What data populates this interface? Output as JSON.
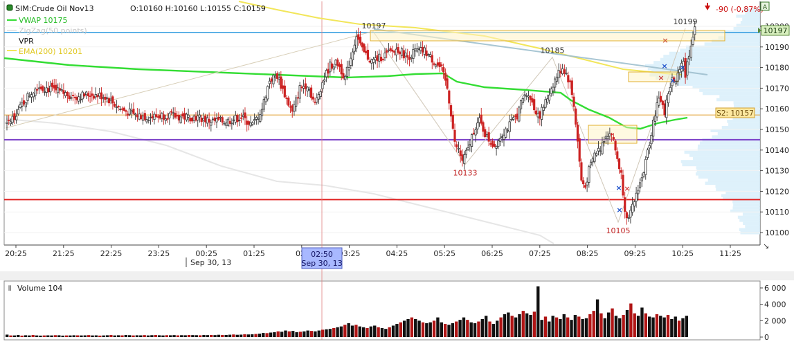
{
  "header": {
    "instrument": "SIM:Crude Oil Nov13",
    "ohlc": "O:10160 H:10160 L:10155 C:10159",
    "change": "-90 (-0,87%)"
  },
  "legend": {
    "vwap": "VWAP  10175",
    "zigzag": "ZigZag(50 points)",
    "vpr": "VPR",
    "ema": "EMA(200)  10201"
  },
  "colors": {
    "candle_up": "#333333",
    "candle_down": "#cc2222",
    "vwap": "#33dd33",
    "ema": "#f2e65a",
    "blue_line": "#3aa0e0",
    "purple_line": "#7a3fc8",
    "red_line": "#e02020",
    "s2_line": "#e0a030",
    "crosshair": "#e08080",
    "volume_up": "#111111",
    "volume_down": "#b01515"
  },
  "chart_data": [
    {
      "type": "candlestick",
      "ylim": [
        10095,
        10210
      ],
      "y_ticks": [
        "10100",
        "10110",
        "10120",
        "10130",
        "10140",
        "10150",
        "10160",
        "10170",
        "10180",
        "10190",
        "10200"
      ],
      "x_tick_labels": [
        "20:25",
        "21:25",
        "22:25",
        "23:25",
        "00:25",
        "01:25",
        "02:",
        "03:25",
        "04:25",
        "05:25",
        "06:25",
        "07:25",
        "08:25",
        "09:25",
        "10:25",
        "11:25"
      ],
      "date_label": "Sep 30, 13",
      "cursor_time": "02:50",
      "cursor_date": "Sep 30, 13",
      "last_price_label": "10197",
      "support_label": "S2: 10157",
      "zigzag_points": [
        {
          "time": "03:55",
          "price": 10197,
          "label": "10197"
        },
        {
          "time": "05:45",
          "price": 10133,
          "label": "10133"
        },
        {
          "time": "07:35",
          "price": 10185,
          "label": "10185"
        },
        {
          "time": "08:55",
          "price": 10105,
          "label": "10105"
        },
        {
          "time": "10:25",
          "price": 10199,
          "label": "10199"
        }
      ],
      "levels": [
        {
          "name": "blue",
          "price": 10197
        },
        {
          "name": "s2",
          "price": 10157
        },
        {
          "name": "purple",
          "price": 10145
        },
        {
          "name": "red",
          "price": 10116
        }
      ],
      "price_path": [
        [
          0,
          10152
        ],
        [
          5,
          10158
        ],
        [
          11,
          10166
        ],
        [
          16,
          10171
        ],
        [
          21,
          10170
        ],
        [
          28,
          10168
        ],
        [
          36,
          10166
        ],
        [
          44,
          10167
        ],
        [
          52,
          10166
        ],
        [
          60,
          10160
        ],
        [
          68,
          10157
        ],
        [
          76,
          10156
        ],
        [
          84,
          10157
        ],
        [
          92,
          10156
        ],
        [
          100,
          10156
        ],
        [
          108,
          10154
        ],
        [
          116,
          10154
        ],
        [
          124,
          10156
        ],
        [
          130,
          10152
        ],
        [
          135,
          10160
        ],
        [
          139,
          10174
        ],
        [
          143,
          10176
        ],
        [
          147,
          10167
        ],
        [
          151,
          10158
        ],
        [
          155,
          10170
        ],
        [
          159,
          10172
        ],
        [
          163,
          10162
        ],
        [
          167,
          10173
        ],
        [
          171,
          10181
        ],
        [
          175,
          10182
        ],
        [
          179,
          10175
        ],
        [
          182,
          10185
        ],
        [
          185,
          10196
        ],
        [
          188,
          10188
        ],
        [
          193,
          10183
        ],
        [
          200,
          10186
        ],
        [
          207,
          10189
        ],
        [
          212,
          10185
        ],
        [
          216,
          10188
        ],
        [
          221,
          10188
        ],
        [
          225,
          10184
        ],
        [
          230,
          10179
        ],
        [
          233,
          10170
        ],
        [
          235,
          10158
        ],
        [
          237,
          10143
        ],
        [
          239,
          10140
        ],
        [
          241,
          10135
        ],
        [
          244,
          10140
        ],
        [
          247,
          10150
        ],
        [
          250,
          10154
        ],
        [
          254,
          10146
        ],
        [
          258,
          10142
        ],
        [
          262,
          10148
        ],
        [
          266,
          10152
        ],
        [
          270,
          10157
        ],
        [
          273,
          10165
        ],
        [
          276,
          10168
        ],
        [
          279,
          10160
        ],
        [
          282,
          10157
        ],
        [
          285,
          10163
        ],
        [
          288,
          10170
        ],
        [
          291,
          10176
        ],
        [
          294,
          10180
        ],
        [
          296,
          10177
        ],
        [
          298,
          10172
        ],
        [
          300,
          10162
        ],
        [
          302,
          10144
        ],
        [
          304,
          10125
        ],
        [
          306,
          10122
        ],
        [
          308,
          10130
        ],
        [
          311,
          10138
        ],
        [
          314,
          10141
        ],
        [
          317,
          10148
        ],
        [
          320,
          10148
        ],
        [
          322,
          10140
        ],
        [
          325,
          10128
        ],
        [
          327,
          10112
        ],
        [
          329,
          10106
        ],
        [
          331,
          10112
        ],
        [
          334,
          10122
        ],
        [
          336,
          10126
        ],
        [
          338,
          10134
        ],
        [
          340,
          10144
        ],
        [
          342,
          10154
        ],
        [
          344,
          10162
        ],
        [
          346,
          10165
        ],
        [
          348,
          10158
        ],
        [
          350,
          10168
        ],
        [
          352,
          10174
        ],
        [
          354,
          10172
        ],
        [
          356,
          10181
        ],
        [
          358,
          10184
        ],
        [
          359,
          10176
        ],
        [
          360,
          10182
        ],
        [
          362,
          10192
        ],
        [
          364,
          10198
        ]
      ],
      "volume": {
        "label": "Volume 104",
        "ylim": [
          0,
          7000
        ],
        "ticks": [
          "0",
          "2 000",
          "4 000",
          "6 000"
        ],
        "values": [
          300,
          200,
          200,
          250,
          180,
          220,
          200,
          250,
          200,
          180,
          200,
          210,
          200,
          230,
          220,
          180,
          200,
          200,
          220,
          210,
          200,
          210,
          240,
          200,
          210,
          180,
          200,
          220,
          250,
          200,
          220,
          210,
          250,
          230,
          200,
          220,
          210,
          240,
          200,
          230,
          250,
          220,
          200,
          230,
          220,
          240,
          210,
          230,
          220,
          260,
          240,
          230,
          220,
          250,
          240,
          260,
          240,
          280,
          250,
          260,
          290,
          320,
          280,
          300,
          350,
          320,
          340,
          380,
          420,
          500,
          480,
          550,
          600,
          700,
          650,
          800,
          700,
          750,
          600,
          650,
          700,
          800,
          750,
          700,
          800,
          900,
          950,
          1000,
          1100,
          1200,
          1300,
          1500,
          1700,
          1400,
          1500,
          1300,
          1200,
          1100,
          1300,
          1400,
          1200,
          1100,
          1000,
          1200,
          1400,
          1600,
          1800,
          2000,
          2200,
          2400,
          2200,
          2000,
          1800,
          1700,
          1800,
          2000,
          2400,
          1800,
          1600,
          1500,
          1700,
          1900,
          2100,
          2400,
          2100,
          1800,
          1700,
          1900,
          2200,
          2600,
          1900,
          1600,
          2000,
          2400,
          2800,
          3000,
          2600,
          2400,
          2800,
          3200,
          2900,
          2700,
          3100,
          6200,
          2100,
          2500,
          1900,
          2600,
          2400,
          2200,
          2800,
          2400,
          2100,
          2700,
          2500,
          2200,
          2300,
          2800,
          3200,
          4600,
          2900,
          2300,
          3000,
          3500,
          2600,
          2300,
          2700,
          3300,
          4100,
          2900,
          2600,
          3600,
          2900,
          2500,
          2400,
          2800,
          2600,
          2400,
          2700,
          2200,
          2500,
          2000,
          2300,
          2600
        ]
      }
    }
  ]
}
